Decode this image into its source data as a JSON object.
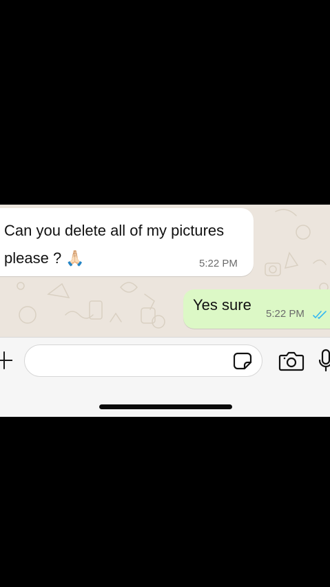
{
  "messages": {
    "incoming": {
      "text_line1": "Can you delete all of my pictures",
      "text_line2": "please ?",
      "emoji": "🙏🏻",
      "time": "5:22 PM"
    },
    "outgoing": {
      "text": "Yes sure",
      "time": "5:22 PM",
      "status_icon": "double-check-read-icon"
    }
  },
  "input_bar": {
    "text_value": "",
    "icons": [
      "plus-icon",
      "sticker-icon",
      "camera-icon",
      "microphone-icon"
    ]
  },
  "colors": {
    "chat_wallpaper": "#ece5dd",
    "incoming_bubble": "#ffffff",
    "outgoing_bubble": "#dcf8c6",
    "read_ticks": "#34b7f1"
  }
}
